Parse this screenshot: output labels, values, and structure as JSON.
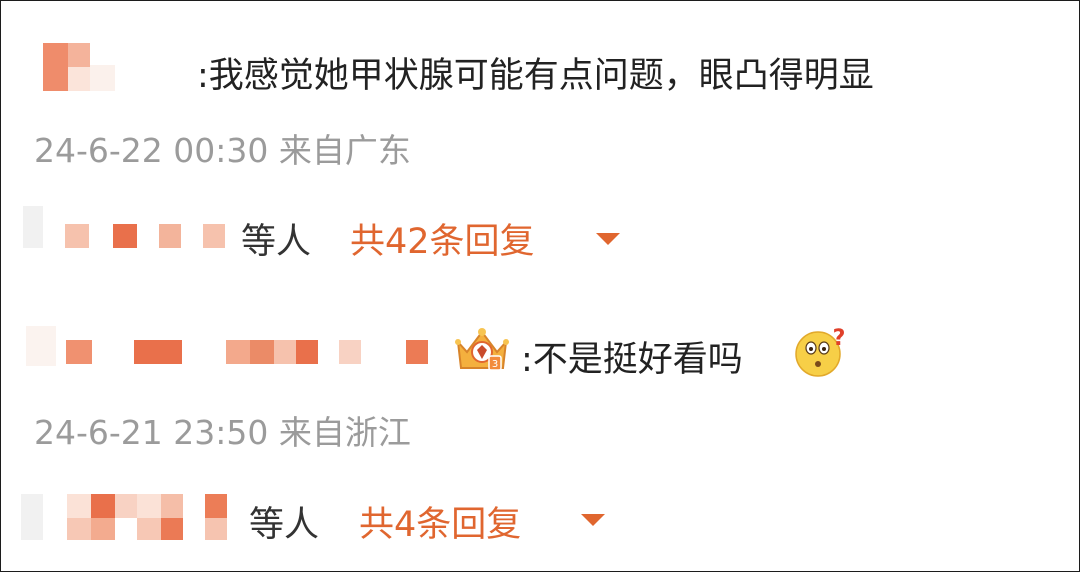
{
  "thread": {
    "comments": [
      {
        "text": ":我感觉她甲状腺可能有点问题，眼凸得明显",
        "meta": "24-6-22 00:30 来自广东",
        "replies": {
          "who_suffix": "等人",
          "count_label": "共42条回复"
        }
      },
      {
        "text": ":不是挺好看吗",
        "meta": "24-6-21 23:50 来自浙江",
        "badge_icon": "crown-level-badge-icon",
        "emoji_icon": "confused-face-emoji-icon",
        "replies": {
          "who_suffix": "等人",
          "count_label": "共4条回复"
        }
      }
    ]
  },
  "colors": {
    "accent": "#e0662f",
    "meta_gray": "#9b9b9b",
    "text": "#222222",
    "mosaic_light": "#f6c9b6",
    "mosaic_mid": "#ef9a79",
    "mosaic_dark": "#e8704a"
  }
}
